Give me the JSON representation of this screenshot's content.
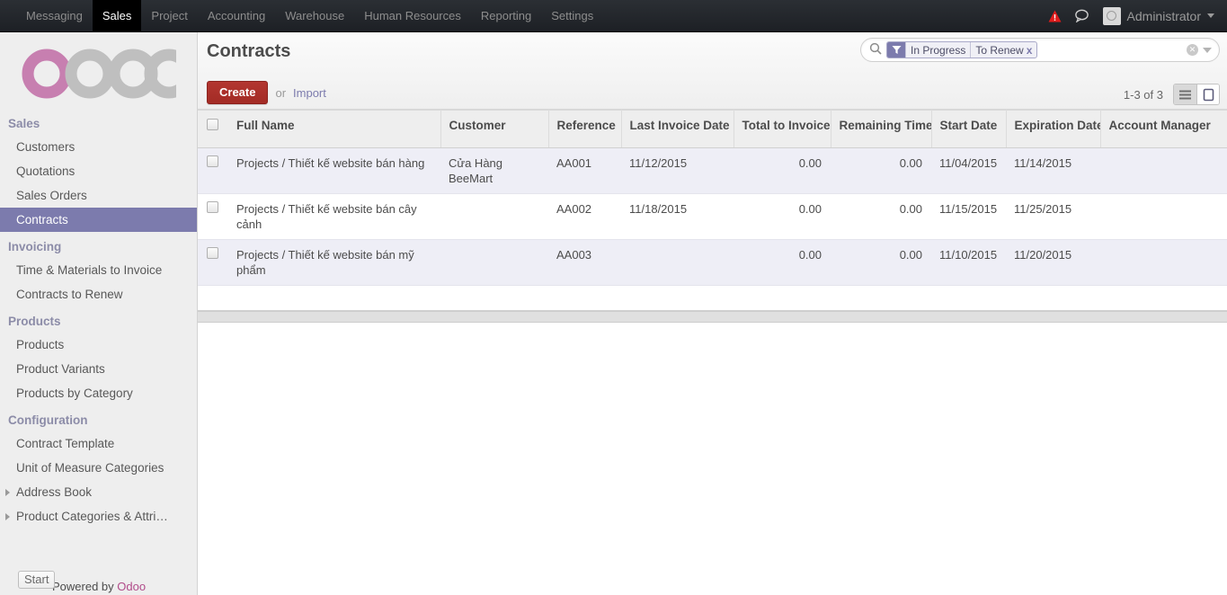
{
  "topnav": {
    "items": [
      {
        "label": "Messaging",
        "active": false
      },
      {
        "label": "Sales",
        "active": true
      },
      {
        "label": "Project",
        "active": false
      },
      {
        "label": "Accounting",
        "active": false
      },
      {
        "label": "Warehouse",
        "active": false
      },
      {
        "label": "Human Resources",
        "active": false
      },
      {
        "label": "Reporting",
        "active": false
      },
      {
        "label": "Settings",
        "active": false
      }
    ],
    "warning_icon": "warning-triangle-icon",
    "chat_icon": "chat-bubble-icon",
    "user_name": "Administrator",
    "warning_color": "#e01b1b"
  },
  "sidebar": {
    "logo_text": "odoo",
    "logo_accent_color": "#b14c8a",
    "logo_gray_color": "#bdbdbd",
    "groups": [
      {
        "title": "Sales",
        "items": [
          {
            "label": "Customers",
            "active": false,
            "expandable": false
          },
          {
            "label": "Quotations",
            "active": false,
            "expandable": false
          },
          {
            "label": "Sales Orders",
            "active": false,
            "expandable": false
          },
          {
            "label": "Contracts",
            "active": true,
            "expandable": false
          }
        ]
      },
      {
        "title": "Invoicing",
        "items": [
          {
            "label": "Time & Materials to Invoice",
            "active": false,
            "expandable": false
          },
          {
            "label": "Contracts to Renew",
            "active": false,
            "expandable": false
          }
        ]
      },
      {
        "title": "Products",
        "items": [
          {
            "label": "Products",
            "active": false,
            "expandable": false
          },
          {
            "label": "Product Variants",
            "active": false,
            "expandable": false
          },
          {
            "label": "Products by Category",
            "active": false,
            "expandable": false
          }
        ]
      },
      {
        "title": "Configuration",
        "items": [
          {
            "label": "Contract Template",
            "active": false,
            "expandable": false
          },
          {
            "label": "Unit of Measure Categories",
            "active": false,
            "expandable": false
          },
          {
            "label": "Address Book",
            "active": false,
            "expandable": true
          },
          {
            "label": "Product Categories & Attri…",
            "active": false,
            "expandable": true
          }
        ]
      }
    ],
    "active_bg_color": "#7c7bad",
    "start_button": "Start",
    "powered_by_prefix": "Powered by ",
    "powered_by_brand": "Odoo"
  },
  "control_panel": {
    "title": "Contracts",
    "create_label": "Create",
    "or_label": "or",
    "import_label": "Import",
    "pager": "1-3 of 3",
    "views": [
      {
        "name": "list-view-button",
        "active": true
      },
      {
        "name": "form-view-button",
        "active": false
      }
    ]
  },
  "search": {
    "magnifier_icon": "search-icon",
    "facet_icon": "filter-funnel-icon",
    "facet_values": [
      "In Progress",
      "To Renew"
    ],
    "facet_remove": "x",
    "placeholder": "",
    "value": "",
    "clear_icon": "clear-circle-icon",
    "dropdown_icon": "chevron-down-icon",
    "facet_color": "#7c7bad"
  },
  "table": {
    "columns": [
      {
        "key": "full_name",
        "label": "Full Name",
        "align": "left"
      },
      {
        "key": "customer",
        "label": "Customer",
        "align": "left"
      },
      {
        "key": "reference",
        "label": "Reference",
        "align": "left"
      },
      {
        "key": "last_invoice_date",
        "label": "Last Invoice Date",
        "align": "left"
      },
      {
        "key": "total_to_invoice",
        "label": "Total to Invoice",
        "align": "right"
      },
      {
        "key": "remaining_time",
        "label": "Remaining Time",
        "align": "right"
      },
      {
        "key": "start_date",
        "label": "Start Date",
        "align": "left"
      },
      {
        "key": "expiration_date",
        "label": "Expiration Date",
        "align": "left"
      },
      {
        "key": "account_manager",
        "label": "Account Manager",
        "align": "left"
      }
    ],
    "rows": [
      {
        "full_name": "Projects / Thiết kế website bán hàng",
        "customer": "Cửa Hàng BeeMart",
        "reference": "AA001",
        "last_invoice_date": "11/12/2015",
        "total_to_invoice": "0.00",
        "remaining_time": "0.00",
        "start_date": "11/04/2015",
        "expiration_date": "11/14/2015",
        "account_manager": ""
      },
      {
        "full_name": "Projects / Thiết kế website bán cây cảnh",
        "customer": "",
        "reference": "AA002",
        "last_invoice_date": "11/18/2015",
        "total_to_invoice": "0.00",
        "remaining_time": "0.00",
        "start_date": "11/15/2015",
        "expiration_date": "11/25/2015",
        "account_manager": ""
      },
      {
        "full_name": "Projects / Thiết kế website bán mỹ phẩm",
        "customer": "",
        "reference": "AA003",
        "last_invoice_date": "",
        "total_to_invoice": "0.00",
        "remaining_time": "0.00",
        "start_date": "11/10/2015",
        "expiration_date": "11/20/2015",
        "account_manager": ""
      }
    ]
  }
}
